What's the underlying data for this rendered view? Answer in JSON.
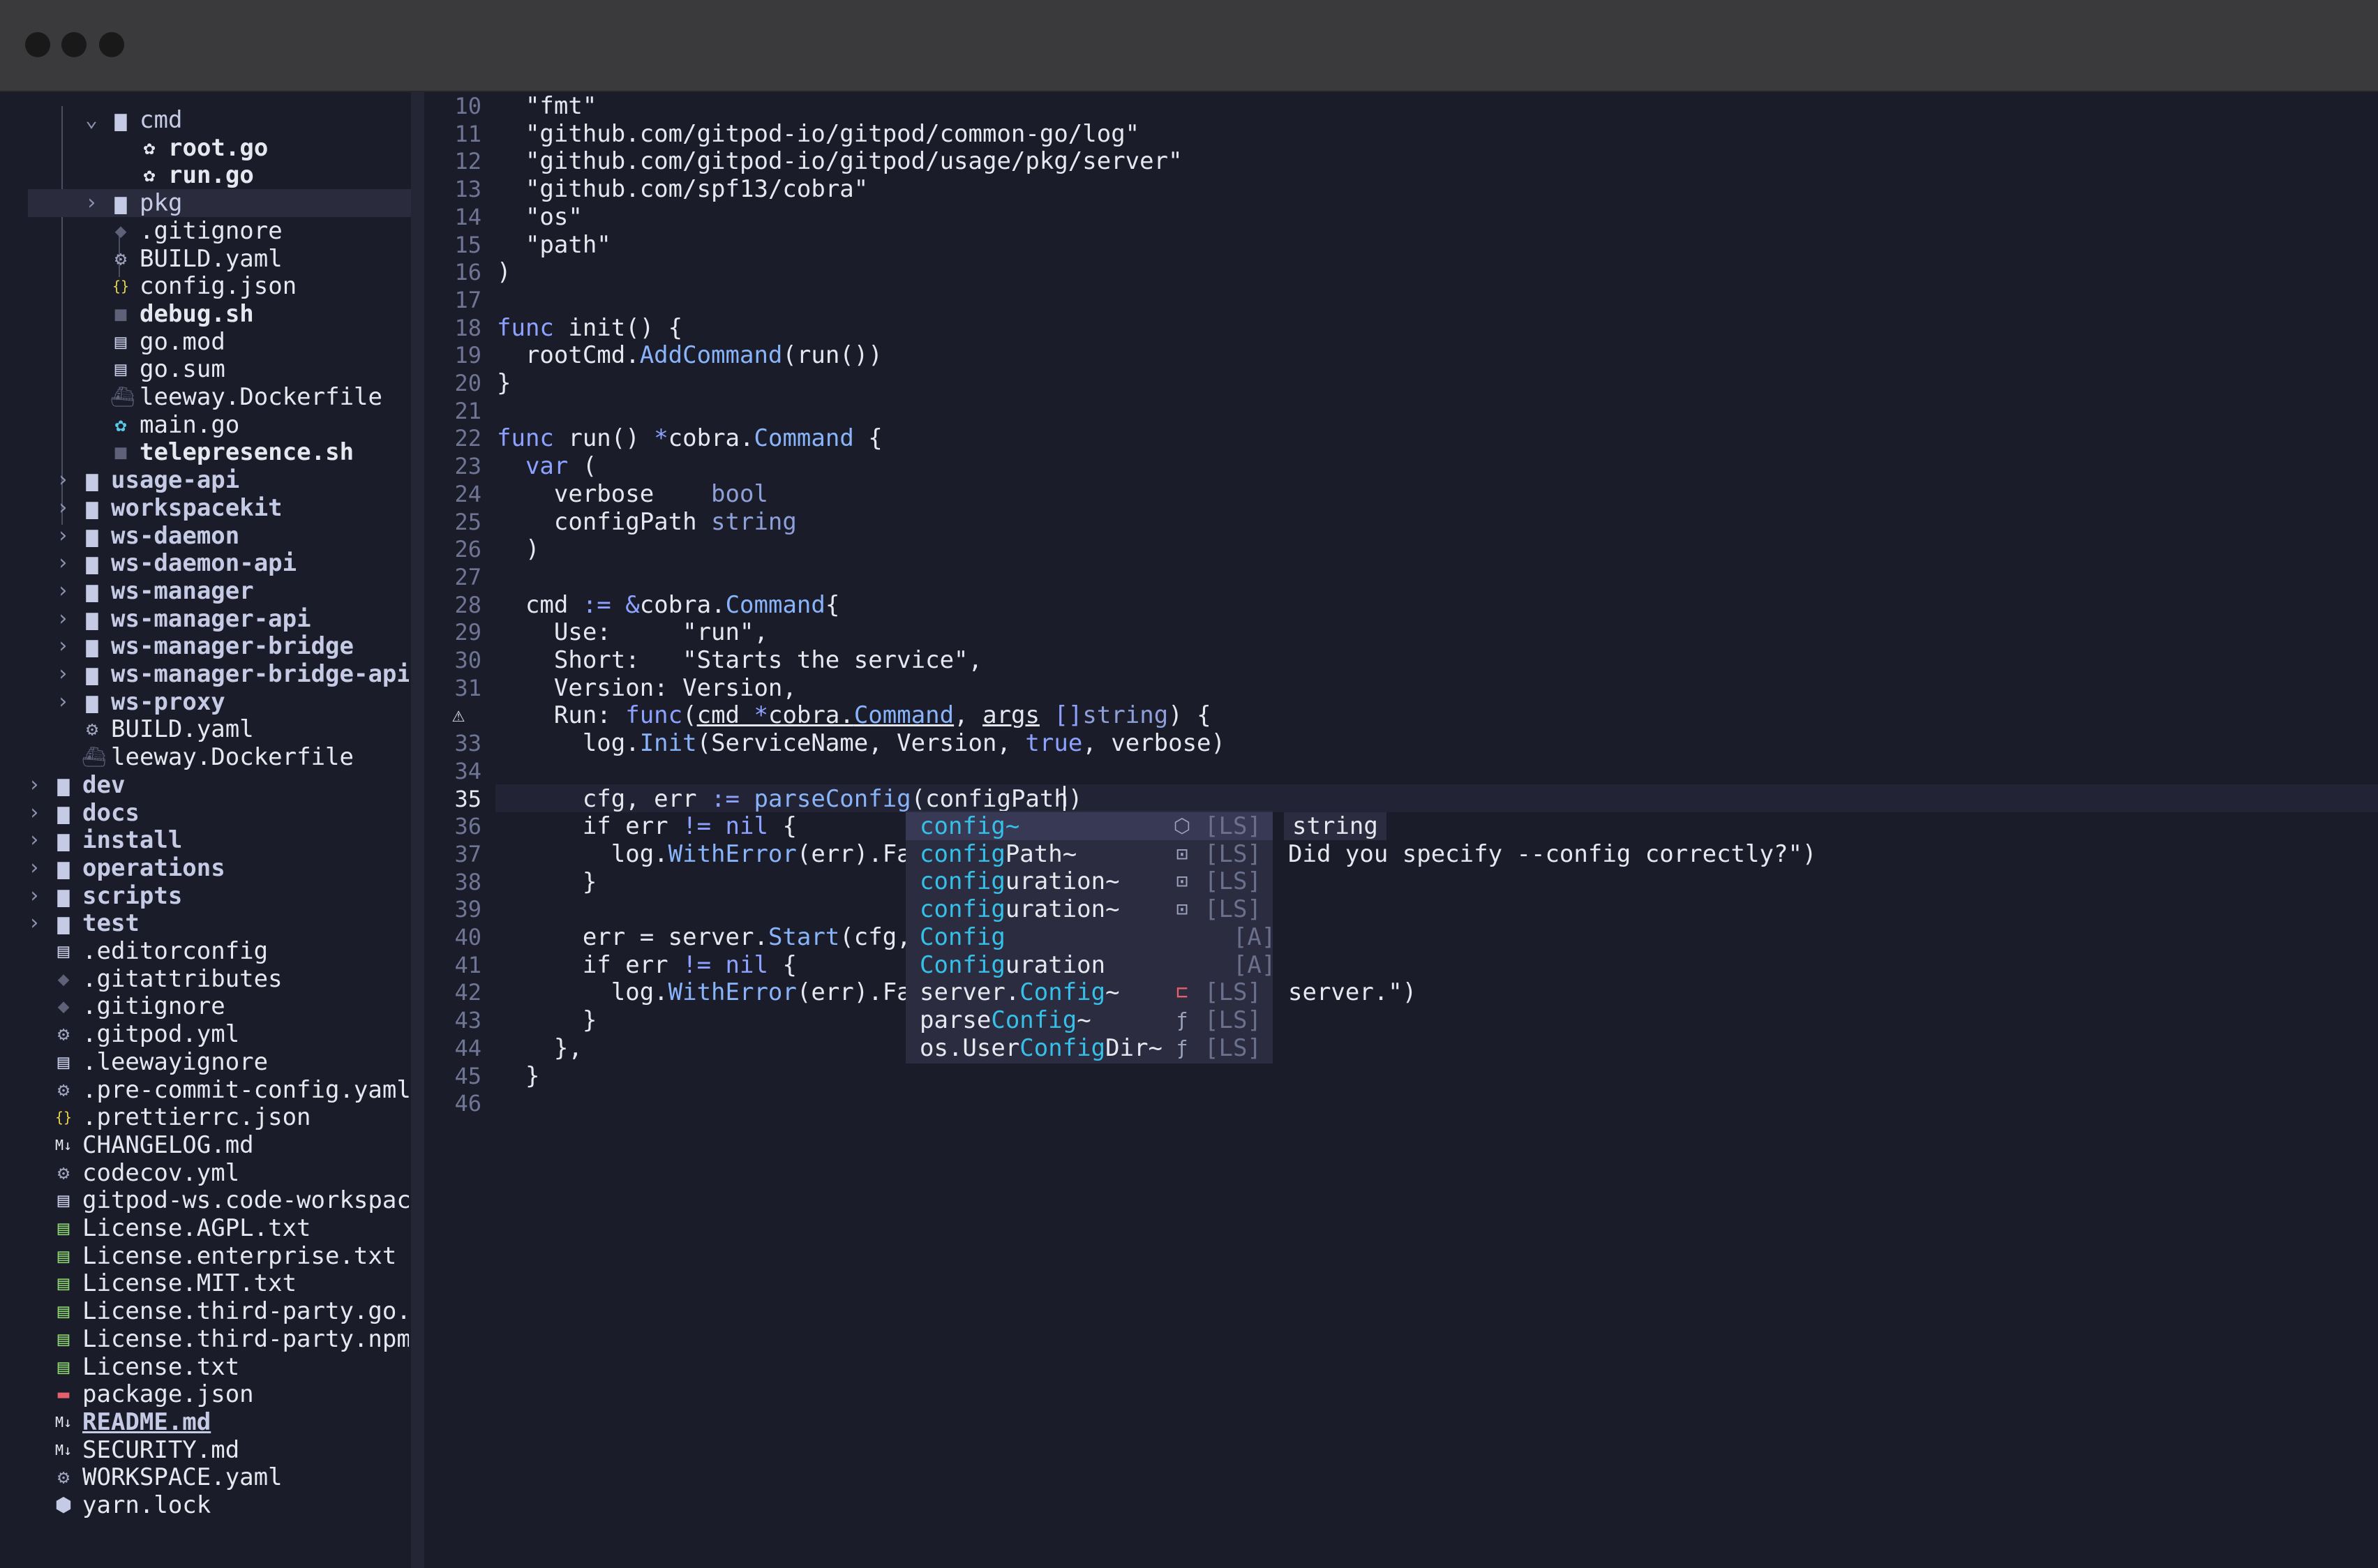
{
  "window": {
    "traffic_lights": [
      "close",
      "minimize",
      "zoom"
    ]
  },
  "file_tree": {
    "items": [
      {
        "name": "cmd",
        "type": "folder",
        "open": true,
        "depth": 3
      },
      {
        "name": "root.go",
        "type": "go",
        "depth": 4,
        "bold": true
      },
      {
        "name": "run.go",
        "type": "go",
        "depth": 4,
        "bold": true
      },
      {
        "name": "pkg",
        "type": "folder",
        "open": false,
        "depth": 3,
        "selected": true
      },
      {
        "name": ".gitignore",
        "type": "git",
        "depth": 3
      },
      {
        "name": "BUILD.yaml",
        "type": "config",
        "depth": 3
      },
      {
        "name": "config.json",
        "type": "json",
        "depth": 3
      },
      {
        "name": "debug.sh",
        "type": "shell",
        "depth": 3,
        "bold": true
      },
      {
        "name": "go.mod",
        "type": "doc",
        "depth": 3
      },
      {
        "name": "go.sum",
        "type": "doc",
        "depth": 3
      },
      {
        "name": "leeway.Dockerfile",
        "type": "docker",
        "depth": 3
      },
      {
        "name": "main.go",
        "type": "go-main",
        "depth": 3
      },
      {
        "name": "telepresence.sh",
        "type": "shell",
        "depth": 3,
        "bold": true
      },
      {
        "name": "usage-api",
        "type": "folder",
        "open": false,
        "depth": 2,
        "bold": true
      },
      {
        "name": "workspacekit",
        "type": "folder",
        "open": false,
        "depth": 2,
        "bold": true
      },
      {
        "name": "ws-daemon",
        "type": "folder",
        "open": false,
        "depth": 2,
        "bold": true
      },
      {
        "name": "ws-daemon-api",
        "type": "folder",
        "open": false,
        "depth": 2,
        "bold": true
      },
      {
        "name": "ws-manager",
        "type": "folder",
        "open": false,
        "depth": 2,
        "bold": true
      },
      {
        "name": "ws-manager-api",
        "type": "folder",
        "open": false,
        "depth": 2,
        "bold": true
      },
      {
        "name": "ws-manager-bridge",
        "type": "folder",
        "open": false,
        "depth": 2,
        "bold": true
      },
      {
        "name": "ws-manager-bridge-api",
        "type": "folder",
        "open": false,
        "depth": 2,
        "bold": true
      },
      {
        "name": "ws-proxy",
        "type": "folder",
        "open": false,
        "depth": 2,
        "bold": true
      },
      {
        "name": "BUILD.yaml",
        "type": "config",
        "depth": 2
      },
      {
        "name": "leeway.Dockerfile",
        "type": "docker",
        "depth": 2
      },
      {
        "name": "dev",
        "type": "folder",
        "open": false,
        "depth": 1,
        "bold": true
      },
      {
        "name": "docs",
        "type": "folder",
        "open": false,
        "depth": 1,
        "bold": true
      },
      {
        "name": "install",
        "type": "folder",
        "open": false,
        "depth": 1,
        "bold": true
      },
      {
        "name": "operations",
        "type": "folder",
        "open": false,
        "depth": 1,
        "bold": true
      },
      {
        "name": "scripts",
        "type": "folder",
        "open": false,
        "depth": 1,
        "bold": true
      },
      {
        "name": "test",
        "type": "folder",
        "open": false,
        "depth": 1,
        "bold": true
      },
      {
        "name": ".editorconfig",
        "type": "doc",
        "depth": 1
      },
      {
        "name": ".gitattributes",
        "type": "git",
        "depth": 1
      },
      {
        "name": ".gitignore",
        "type": "git",
        "depth": 1
      },
      {
        "name": ".gitpod.yml",
        "type": "config",
        "depth": 1
      },
      {
        "name": ".leewayignore",
        "type": "doc",
        "depth": 1
      },
      {
        "name": ".pre-commit-config.yaml",
        "type": "config",
        "depth": 1
      },
      {
        "name": ".prettierrc.json",
        "type": "json",
        "depth": 1
      },
      {
        "name": "CHANGELOG.md",
        "type": "md",
        "depth": 1
      },
      {
        "name": "codecov.yml",
        "type": "config",
        "depth": 1
      },
      {
        "name": "gitpod-ws.code-workspac",
        "type": "doc",
        "depth": 1
      },
      {
        "name": "License.AGPL.txt",
        "type": "license",
        "depth": 1
      },
      {
        "name": "License.enterprise.txt",
        "type": "license",
        "depth": 1
      },
      {
        "name": "License.MIT.txt",
        "type": "license",
        "depth": 1
      },
      {
        "name": "License.third-party.go.",
        "type": "license",
        "depth": 1
      },
      {
        "name": "License.third-party.npm",
        "type": "license",
        "depth": 1
      },
      {
        "name": "License.txt",
        "type": "license",
        "depth": 1
      },
      {
        "name": "package.json",
        "type": "npm",
        "depth": 1
      },
      {
        "name": "README.md",
        "type": "md",
        "depth": 1,
        "bold": true,
        "underline": true
      },
      {
        "name": "SECURITY.md",
        "type": "md",
        "depth": 1
      },
      {
        "name": "WORKSPACE.yaml",
        "type": "config",
        "depth": 1
      },
      {
        "name": "yarn.lock",
        "type": "lock",
        "depth": 1
      }
    ]
  },
  "editor": {
    "current_line": 35,
    "warning_line": 32,
    "lines": [
      {
        "n": 10,
        "code": "  \"fmt\""
      },
      {
        "n": 11,
        "code": "  \"github.com/gitpod-io/gitpod/common-go/log\""
      },
      {
        "n": 12,
        "code": "  \"github.com/gitpod-io/gitpod/usage/pkg/server\""
      },
      {
        "n": 13,
        "code": "  \"github.com/spf13/cobra\""
      },
      {
        "n": 14,
        "code": "  \"os\""
      },
      {
        "n": 15,
        "code": "  \"path\""
      },
      {
        "n": 16,
        "code": ")"
      },
      {
        "n": 17,
        "code": ""
      },
      {
        "n": 18,
        "code": "func init() {"
      },
      {
        "n": 19,
        "code": "  rootCmd.AddCommand(run())"
      },
      {
        "n": 20,
        "code": "}"
      },
      {
        "n": 21,
        "code": ""
      },
      {
        "n": 22,
        "code": "func run() *cobra.Command {"
      },
      {
        "n": 23,
        "code": "  var ("
      },
      {
        "n": 24,
        "code": "    verbose    bool"
      },
      {
        "n": 25,
        "code": "    configPath string"
      },
      {
        "n": 26,
        "code": "  )"
      },
      {
        "n": 27,
        "code": ""
      },
      {
        "n": 28,
        "code": "  cmd := &cobra.Command{"
      },
      {
        "n": 29,
        "code": "    Use:     \"run\","
      },
      {
        "n": 30,
        "code": "    Short:   \"Starts the service\","
      },
      {
        "n": 31,
        "code": "    Version: Version,"
      },
      {
        "n": 32,
        "code": "    Run: func(cmd *cobra.Command, args []string) {"
      },
      {
        "n": 33,
        "code": "      log.Init(ServiceName, Version, true, verbose)"
      },
      {
        "n": 34,
        "code": ""
      },
      {
        "n": 35,
        "code": "      cfg, err := parseConfig(configPath)"
      },
      {
        "n": 36,
        "code": "      if err != nil {"
      },
      {
        "n": 37,
        "code": "        log.WithError(err).Fa"
      },
      {
        "n": 38,
        "code": "      }"
      },
      {
        "n": 39,
        "code": ""
      },
      {
        "n": 40,
        "code": "      err = server.Start(cfg,"
      },
      {
        "n": 41,
        "code": "      if err != nil {"
      },
      {
        "n": 42,
        "code": "        log.WithError(err).Fa"
      },
      {
        "n": 43,
        "code": "      }"
      },
      {
        "n": 44,
        "code": "    },"
      },
      {
        "n": 45,
        "code": "  }"
      },
      {
        "n": 46,
        "code": ""
      }
    ],
    "tails": [
      {
        "n": 37,
        "text": "Did you specify --config correctly?\")"
      },
      {
        "n": 42,
        "text": "server.\")"
      }
    ]
  },
  "completion": {
    "signature": "string",
    "items": [
      {
        "pre": "",
        "hl": "config",
        "post": "~",
        "kind": "⬡",
        "kind_name": "variable-icon",
        "src": "[LS]",
        "selected": true
      },
      {
        "pre": "",
        "hl": "config",
        "post": "Path~",
        "kind": "⊡",
        "kind_name": "field-icon",
        "src": "[LS]"
      },
      {
        "pre": "",
        "hl": "config",
        "post": "uration~",
        "kind": "⊡",
        "kind_name": "field-icon",
        "src": "[LS]"
      },
      {
        "pre": "",
        "hl": "config",
        "post": "uration~",
        "kind": "⊡",
        "kind_name": "field-icon",
        "src": "[LS]"
      },
      {
        "pre": "",
        "hl": "Config",
        "post": "",
        "kind": "",
        "kind_name": "",
        "src": "[A]"
      },
      {
        "pre": "",
        "hl": "Config",
        "post": "uration",
        "kind": "",
        "kind_name": "",
        "src": "[A]"
      },
      {
        "pre": "server.",
        "hl": "Config",
        "post": "~",
        "kind": "⊏",
        "kind_name": "struct-icon",
        "src": "[LS]",
        "red": true
      },
      {
        "pre": "parse",
        "hl": "Config",
        "post": "~",
        "kind": "ƒ",
        "kind_name": "function-icon",
        "src": "[LS]"
      },
      {
        "pre": "os.User",
        "hl": "Config",
        "post": "Dir~",
        "kind": "ƒ",
        "kind_name": "function-icon",
        "src": "[LS]"
      }
    ]
  },
  "colors": {
    "background": "#1b1c2a",
    "titlebar": "#3a3a3c",
    "keyword": "#8da2ff",
    "function": "#89b4fa",
    "match": "#36c0e8",
    "popup": "#2b2c40",
    "popup_selected": "#383a55"
  }
}
